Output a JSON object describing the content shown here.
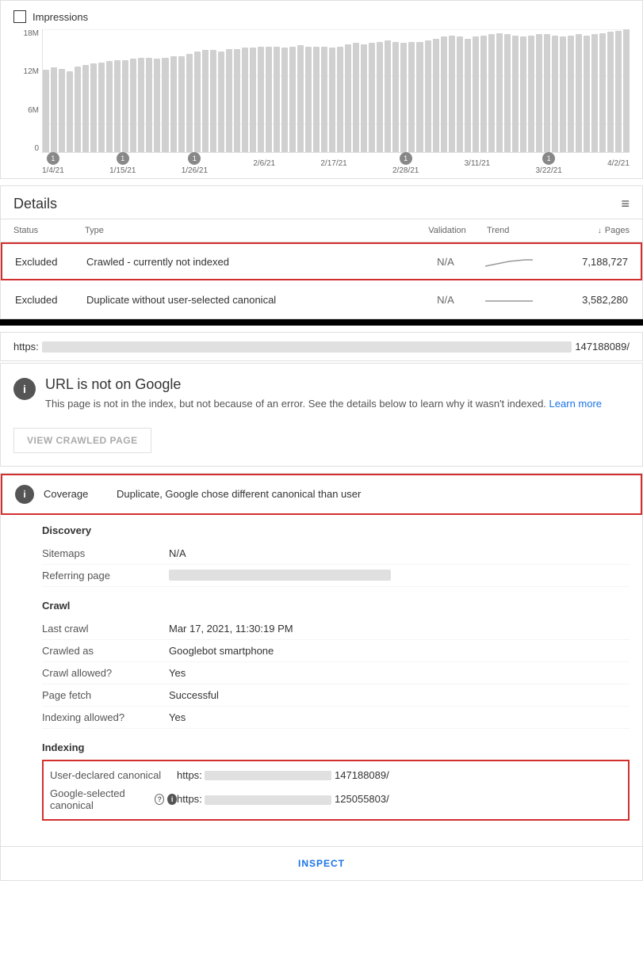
{
  "chart": {
    "title": "Impressions",
    "y_labels": [
      "18M",
      "12M",
      "6M",
      "0"
    ],
    "x_labels": [
      {
        "date": "1/4/21",
        "annotation": true
      },
      {
        "date": "1/15/21",
        "annotation": true
      },
      {
        "date": "1/26/21",
        "annotation": true
      },
      {
        "date": "2/6/21",
        "annotation": false
      },
      {
        "date": "2/17/21",
        "annotation": false
      },
      {
        "date": "2/28/21",
        "annotation": true
      },
      {
        "date": "3/11/21",
        "annotation": false
      },
      {
        "date": "3/22/21",
        "annotation": true
      },
      {
        "date": "4/2/21",
        "annotation": false
      }
    ],
    "bars": [
      62,
      64,
      63,
      61,
      65,
      66,
      67,
      68,
      69,
      70,
      70,
      71,
      72,
      72,
      71,
      72,
      73,
      73,
      74,
      76,
      77,
      77,
      76,
      78,
      78,
      79,
      79,
      80,
      80,
      80,
      79,
      80,
      81,
      80,
      80,
      80,
      79,
      80,
      82,
      83,
      82,
      83,
      84,
      85,
      84,
      83,
      84,
      84,
      85,
      86,
      87,
      88,
      87,
      86,
      87,
      88,
      89,
      90,
      89,
      88,
      87,
      88,
      89,
      89,
      88,
      87,
      88,
      89,
      88,
      89,
      90,
      91,
      92,
      93
    ]
  },
  "details": {
    "title": "Details",
    "filter_icon": "≡",
    "columns": {
      "status": "Status",
      "type": "Type",
      "validation": "Validation",
      "trend": "Trend",
      "pages": "Pages"
    },
    "rows": [
      {
        "status": "Excluded",
        "type": "Crawled - currently not indexed",
        "validation": "N/A",
        "pages": "7,188,727",
        "highlighted": true
      },
      {
        "status": "Excluded",
        "type": "Duplicate without user-selected canonical",
        "validation": "N/A",
        "pages": "3,582,280",
        "highlighted": false
      }
    ]
  },
  "url_bar": {
    "prefix": "https:",
    "suffix": "147188089/"
  },
  "info_card": {
    "title": "URL is not on Google",
    "description": "This page is not in the index, but not because of an error. See the details below to learn why it wasn't indexed.",
    "learn_more": "Learn more",
    "button": "VIEW CRAWLED PAGE"
  },
  "coverage": {
    "label": "Coverage",
    "value": "Duplicate, Google chose different canonical than user"
  },
  "discovery": {
    "title": "Discovery",
    "rows": [
      {
        "key": "Sitemaps",
        "value": "N/A"
      },
      {
        "key": "Referring page",
        "value": "redacted"
      }
    ]
  },
  "crawl": {
    "title": "Crawl",
    "rows": [
      {
        "key": "Last crawl",
        "value": "Mar 17, 2021, 11:30:19 PM"
      },
      {
        "key": "Crawled as",
        "value": "Googlebot smartphone"
      },
      {
        "key": "Crawl allowed?",
        "value": "Yes"
      },
      {
        "key": "Page fetch",
        "value": "Successful"
      },
      {
        "key": "Indexing allowed?",
        "value": "Yes"
      }
    ]
  },
  "indexing": {
    "title": "Indexing",
    "rows": [
      {
        "key": "User-declared canonical",
        "value_prefix": "https:",
        "value_suffix": "147188089/",
        "highlighted": true,
        "has_info": false
      },
      {
        "key": "Google-selected canonical",
        "value_prefix": "https:",
        "value_suffix": "125055803/",
        "highlighted": true,
        "has_info": true
      }
    ]
  },
  "inspect_btn": "INSPECT"
}
